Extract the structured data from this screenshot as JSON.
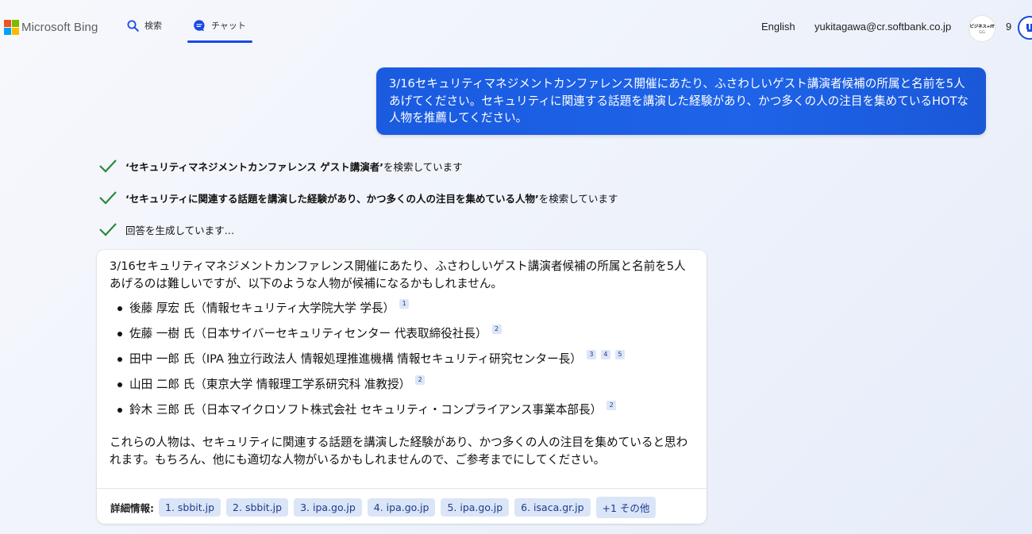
{
  "header": {
    "brand_name": "Microsoft Bing",
    "logo_colors": [
      "#f25022",
      "#7fba00",
      "#00a4ef",
      "#ffb900"
    ],
    "tabs": [
      {
        "label": "検索",
        "icon": "search-icon"
      },
      {
        "label": "チャット",
        "icon": "chat-icon",
        "active": true
      }
    ],
    "language_link": "English",
    "account_email": "yukitagawa@cr.softbank.co.jp",
    "avatar_text": "ビジネス+IT",
    "avatar_subtext": "GG",
    "reward_count": "9",
    "accent_color": "#174ae4"
  },
  "user_message": {
    "text": "3/16セキュリティマネジメントカンファレンス開催にあたり、ふさわしいゲスト講演者候補の所属と名前を5人あげてください。セキュリティに関連する話題を講演した経験があり、かつ多くの人の注目を集めているHOTな人物を推薦してください。"
  },
  "progress": [
    {
      "query": "‘セキュリティマネジメントカンファレンス ゲスト講演者’",
      "suffix": " を検索しています"
    },
    {
      "query": "‘セキュリティに関連する話題を講演した経験があり、かつ多くの人の注目を集めている人物’",
      "suffix": " を検索しています"
    },
    {
      "query": "",
      "suffix": "回答を生成しています…"
    }
  ],
  "answer": {
    "intro": "3/16セキュリティマネジメントカンファレンス開催にあたり、ふさわしいゲスト講演者候補の所属と名前を5人あげるのは難しいですが、以下のような人物が候補になるかもしれません。",
    "candidates": [
      {
        "text": "後藤 厚宏 氏（情報セキュリティ大学院大学 学長）",
        "citations": [
          "1"
        ]
      },
      {
        "text": "佐藤 一樹 氏（日本サイバーセキュリティセンター 代表取締役社長）",
        "citations": [
          "2"
        ]
      },
      {
        "text": "田中 一郎 氏（IPA 独立行政法人 情報処理推進機構 情報セキュリティ研究センター長）",
        "citations": [
          "3",
          "4",
          "5"
        ]
      },
      {
        "text": "山田 二郎 氏（東京大学 情報理工学系研究科 准教授）",
        "citations": [
          "2"
        ]
      },
      {
        "text": "鈴木 三郎 氏（日本マイクロソフト株式会社 セキュリティ・コンプライアンス事業本部長）",
        "citations": [
          "2"
        ]
      }
    ],
    "closing": "これらの人物は、セキュリティに関連する話題を講演した経験があり、かつ多くの人の注目を集めていると思われます。もちろん、他にも適切な人物がいるかもしれませんので、ご参考までにしてください。",
    "sources_label": "詳細情報:",
    "sources": [
      "1. sbbit.jp",
      "2. sbbit.jp",
      "3. ipa.go.jp",
      "4. ipa.go.jp",
      "5. ipa.go.jp",
      "6. isaca.gr.jp",
      "+1 その他"
    ]
  }
}
